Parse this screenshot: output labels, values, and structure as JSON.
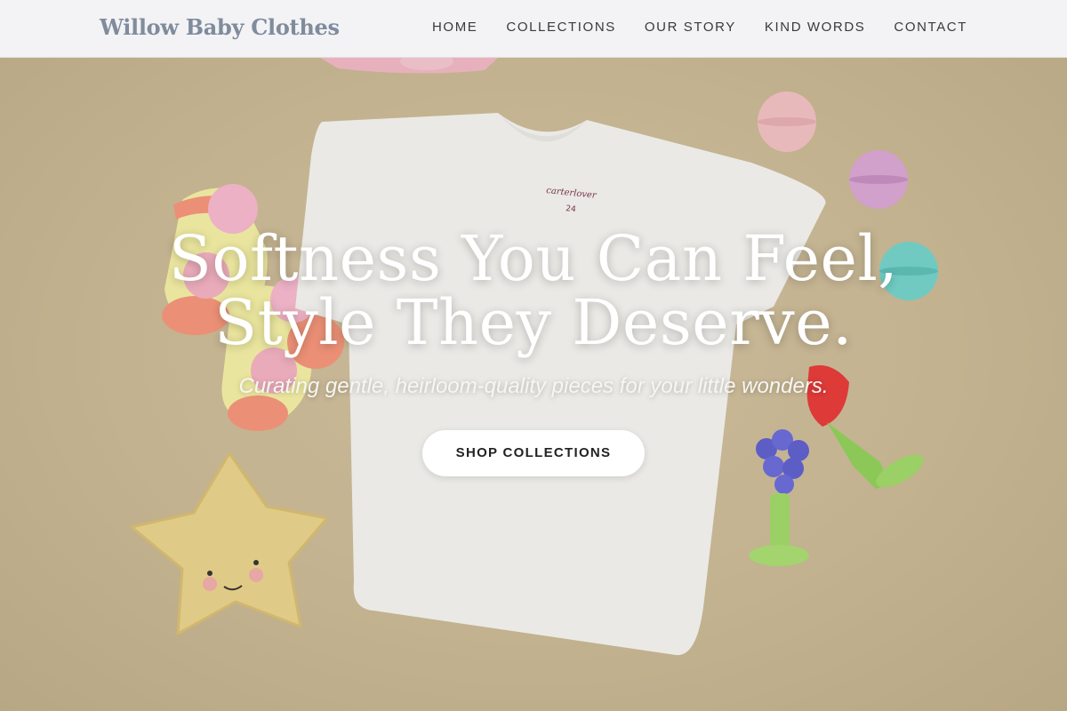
{
  "brand": {
    "name": "Willow Baby Clothes"
  },
  "nav": {
    "items": [
      {
        "label": "HOME"
      },
      {
        "label": "COLLECTIONS"
      },
      {
        "label": "OUR STORY"
      },
      {
        "label": "KIND WORDS"
      },
      {
        "label": "CONTACT"
      }
    ]
  },
  "hero": {
    "title_line1": "Softness You Can Feel,",
    "title_line2": "Style They Deserve.",
    "subtitle": "Curating gentle, heirloom-quality pieces for your little wonders.",
    "cta_label": "SHOP COLLECTIONS",
    "shirt_tag_text": "carterlover",
    "shirt_tag_size": "24"
  },
  "colors": {
    "header_bg": "#f3f2f5",
    "brand_text": "#7f8c9c",
    "hero_bg": "#cdbd9c",
    "cta_bg": "#ffffff"
  }
}
